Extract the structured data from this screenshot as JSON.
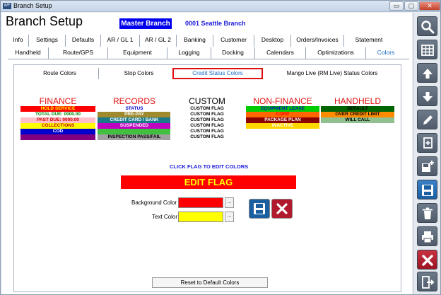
{
  "window": {
    "title": "Branch Setup",
    "min_label": "▭",
    "max_label": "▢",
    "close_label": "✕"
  },
  "header": {
    "page_title": "Branch Setup",
    "master_label": "Master Branch",
    "branch_label": "0001  Seattle Branch"
  },
  "tabs_row1": [
    "Info",
    "Settings",
    "Defaults",
    "AR / GL 1",
    "AR / GL 2",
    "Banking",
    "Customer",
    "Desktop",
    "Orders/Invoices",
    "Statement"
  ],
  "tabs_row2": [
    "Handheld",
    "Route/GPS",
    "Equipment",
    "Logging",
    "Docking",
    "Calendars",
    "Optimizations",
    "Colors"
  ],
  "active_tab": "Colors",
  "subtabs": [
    "Route Colors",
    "Stop Colors",
    "Credit Status Colors",
    "Mango Live (RM Live) Status Colors"
  ],
  "active_subtab": "Credit Status Colors",
  "columns": [
    {
      "heading": "FINANCE",
      "flags": [
        {
          "label": "HOLD SERVICE",
          "bg": "#ff0000",
          "fg": "#ffff00"
        },
        {
          "label": "TOTAL DUE: 0000.00",
          "bg": "#ffffff",
          "fg": "#008000"
        },
        {
          "label": "PAST DUE: 0000.00",
          "bg": "#ffc0cb",
          "fg": "#d00000"
        },
        {
          "label": "COLLECTIONS",
          "bg": "#ffff00",
          "fg": "#c00000"
        },
        {
          "label": "COD",
          "bg": "#0000cc",
          "fg": "#ffffff"
        },
        {
          "label": "",
          "bg": "#800080",
          "fg": "#ffffff"
        }
      ]
    },
    {
      "heading": "RECORDS",
      "flags": [
        {
          "label": "STATUS",
          "bg": "#ffffff",
          "fg": "#0000cc"
        },
        {
          "label": "PRE-PAY",
          "bg": "#a08a2e",
          "fg": "#ffffff"
        },
        {
          "label": "CREDIT CARD / BANK",
          "bg": "#1a7a8a",
          "fg": "#ffffff"
        },
        {
          "label": "SUSPENDED",
          "bg": "#c000c0",
          "fg": "#ffffff"
        },
        {
          "label": "",
          "bg": "#40c040",
          "fg": "#ffffff"
        },
        {
          "label": "INSPECTION PASS/FAIL",
          "bg": "#a0a0a0",
          "fg": "#000000"
        }
      ]
    },
    {
      "heading": "CUSTOM",
      "flags": [
        {
          "label": "CUSTOM FLAG",
          "bg": "#ffffff",
          "fg": "#000000"
        },
        {
          "label": "CUSTOM FLAG",
          "bg": "#ffffff",
          "fg": "#000000"
        },
        {
          "label": "CUSTOM FLAG",
          "bg": "#ffffff",
          "fg": "#000000"
        },
        {
          "label": "CUSTOM FLAG",
          "bg": "#ffffff",
          "fg": "#000000"
        },
        {
          "label": "CUSTOM FLAG",
          "bg": "#ffffff",
          "fg": "#000000"
        },
        {
          "label": "CUSTOM FLAG",
          "bg": "#ffffff",
          "fg": "#000000"
        }
      ]
    },
    {
      "heading": "NON-FINANCE",
      "flags": [
        {
          "label": "EQUIPMENT LEASE",
          "bg": "#00cc00",
          "fg": "#0000cc"
        },
        {
          "label": "CORP",
          "bg": "#ff6600",
          "fg": "#ff0000"
        },
        {
          "label": "PACKAGE PLAN",
          "bg": "#8b0000",
          "fg": "#ffffff"
        },
        {
          "label": "INACTIVE",
          "bg": "#ffd700",
          "fg": "#ffffff"
        }
      ]
    },
    {
      "heading": "HANDHELD",
      "flags": [
        {
          "label": "DEFAULT",
          "bg": "#006400",
          "fg": "#000000"
        },
        {
          "label": "OVER CREDIT LIMIT",
          "bg": "#ff8c00",
          "fg": "#000000"
        },
        {
          "label": "WILL CALL",
          "bg": "#90c090",
          "fg": "#000000"
        }
      ]
    }
  ],
  "editor": {
    "hint": "CLICK FLAG TO EDIT COLORS",
    "preview_label": "EDIT FLAG",
    "bg_label": "Background Color",
    "text_label": "Text Color",
    "bg_color": "#ff0000",
    "text_color": "#ffff00",
    "dots": "..."
  },
  "reset_label": "Reset to Default Colors",
  "toolbar_icons": [
    "search-icon",
    "grid-icon",
    "arrow-up-icon",
    "arrow-down-icon",
    "pencil-icon",
    "copy-add-icon",
    "save-add-icon",
    "save-icon",
    "trash-icon",
    "print-icon",
    "close-icon",
    "exit-icon"
  ]
}
